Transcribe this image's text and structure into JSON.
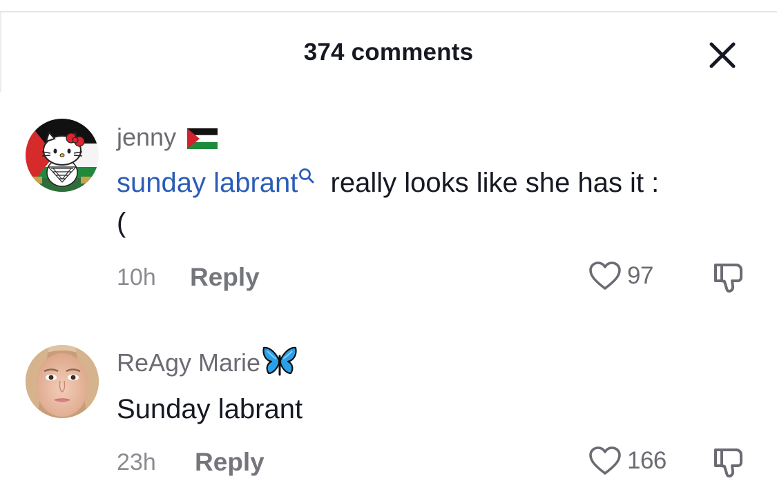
{
  "header": {
    "title": "374 comments",
    "close_icon": "close-icon"
  },
  "comments": [
    {
      "username": "jenny",
      "badge_icon": "palestine-flag-icon",
      "mention": "sunday labrant",
      "mention_icon": "search-icon",
      "text": " really looks like she has it :",
      "text_cont": "(",
      "time": "10h",
      "reply_label": "Reply",
      "likes": "97",
      "like_icon": "heart-outline-icon",
      "dislike_icon": "thumbs-down-icon",
      "avatar": "hello-kitty-keffiyeh-avatar"
    },
    {
      "username": "ReAgy Marie",
      "badge_icon": "blue-butterfly-icon",
      "text": "Sunday labrant",
      "time": "23h",
      "reply_label": "Reply",
      "likes": "166",
      "like_icon": "heart-outline-icon",
      "dislike_icon": "thumbs-down-icon",
      "avatar": "selfie-avatar"
    }
  ]
}
